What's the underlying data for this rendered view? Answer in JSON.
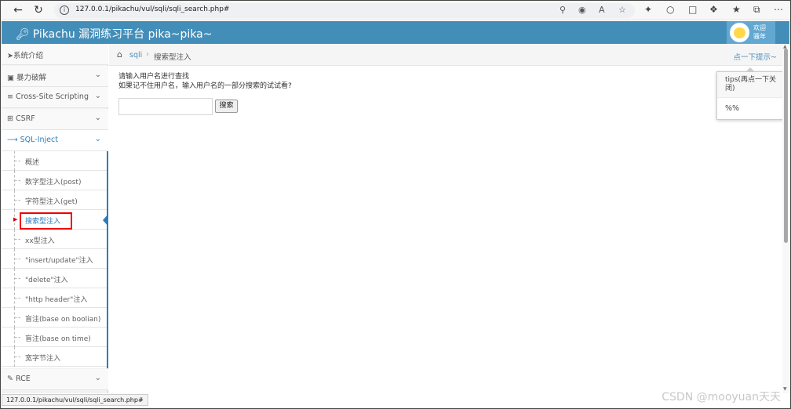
{
  "browser": {
    "url": "127.0.0.1/pikachu/vul/sqli/sqli_search.php#"
  },
  "header": {
    "brand": "Pikachu 漏洞练习平台 pika~pika~",
    "user_line1": "欢迎",
    "user_line2": "骚年"
  },
  "sidebar": {
    "items": [
      {
        "label": "系统介绍"
      },
      {
        "label": "暴力破解"
      },
      {
        "label": "Cross-Site Scripting"
      },
      {
        "label": "CSRF"
      },
      {
        "label": "SQL-Inject"
      },
      {
        "label": "RCE"
      }
    ],
    "subitems": [
      {
        "label": "概述"
      },
      {
        "label": "数字型注入(post)"
      },
      {
        "label": "字符型注入(get)"
      },
      {
        "label": "搜索型注入"
      },
      {
        "label": "xx型注入"
      },
      {
        "label": "\"insert/update\"注入"
      },
      {
        "label": "\"delete\"注入"
      },
      {
        "label": "\"http header\"注入"
      },
      {
        "label": "盲注(base on boolian)"
      },
      {
        "label": "盲注(base on time)"
      },
      {
        "label": "宽字节注入"
      }
    ]
  },
  "breadcrumb": {
    "crumb1": "sqli",
    "crumb2": "搜索型注入",
    "tips_link": "点一下提示~"
  },
  "popover": {
    "title": "tips(再点一下关闭)",
    "body": "%%"
  },
  "main": {
    "line1": "请输入用户名进行查找",
    "line2": "如果记不住用户名，输入用户名的一部分搜索的试试看?",
    "search_value": "",
    "search_button": "搜索"
  },
  "statusbar": "127.0.0.1/pikachu/vul/sqli/sqli_search.php#",
  "watermark": "CSDN @mooyuan天天",
  "colors": {
    "header": "#438eb9",
    "accent": "#2b7dbc",
    "highlight_box": "#ee0000"
  }
}
